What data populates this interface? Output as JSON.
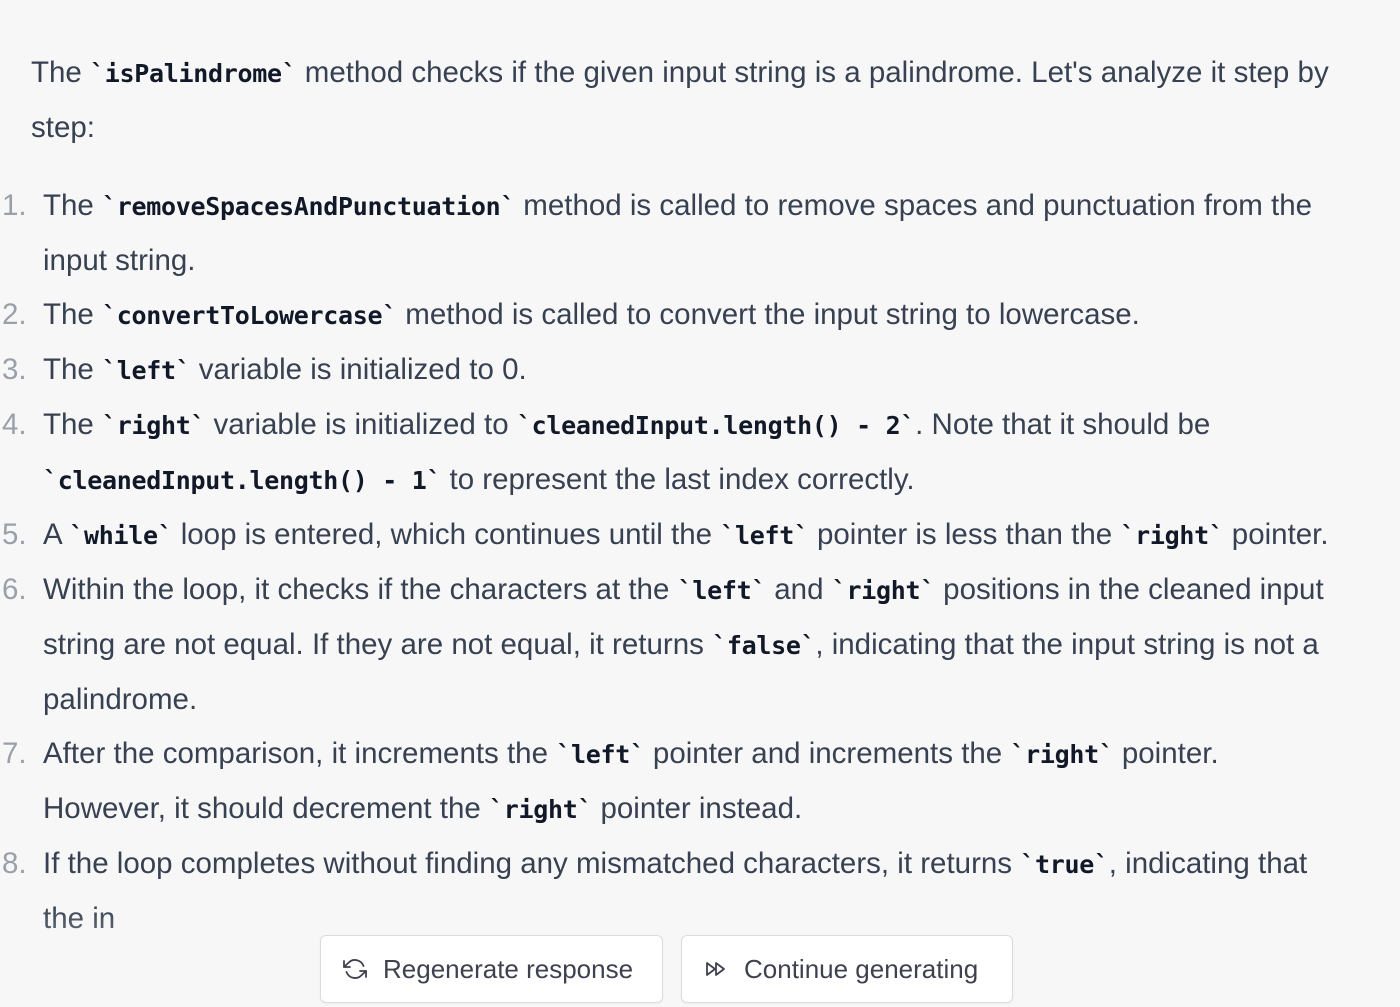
{
  "intro": {
    "t1": "The ",
    "c1": "`isPalindrome`",
    "t2": " method checks if the given input string is a palindrome. Let's analyze it step by step:"
  },
  "steps": [
    {
      "number": "1.",
      "t1": "The ",
      "c1": "`removeSpacesAndPunctuation`",
      "t2": " method is called to remove spaces and punctuation from the input string."
    },
    {
      "number": "2.",
      "t1": "The ",
      "c1": "`convertToLowercase`",
      "t2": " method is called to convert the input string to lowercase."
    },
    {
      "number": "3.",
      "t1": "The ",
      "c1": "`left`",
      "t2": " variable is initialized to 0."
    },
    {
      "number": "4.",
      "t1": "The ",
      "c1": "`right`",
      "t2": " variable is initialized to ",
      "c2": "`cleanedInput.length() - 2`",
      "t3": ". Note that it should be ",
      "c3": "`cleanedInput.length() - 1`",
      "t4": " to represent the last index correctly."
    },
    {
      "number": "5.",
      "t1": "A ",
      "c1": "`while`",
      "t2": " loop is entered, which continues until the ",
      "c2": "`left`",
      "t3": " pointer is less than the ",
      "c3": "`right`",
      "t4": " pointer."
    },
    {
      "number": "6.",
      "t1": "Within the loop, it checks if the characters at the ",
      "c1": "`left`",
      "t2": " and ",
      "c2": "`right`",
      "t3": " positions in the cleaned input string are not equal. If they are not equal, it returns ",
      "c3": "`false`",
      "t4": ", indicating that the input string is not a palindrome."
    },
    {
      "number": "7.",
      "t1": "After the comparison, it increments the ",
      "c1": "`left`",
      "t2": " pointer and increments the ",
      "c2": "`right`",
      "t3": " pointer. However, it should decrement the ",
      "c3": "`right`",
      "t4": " pointer instead."
    },
    {
      "number": "8.",
      "t1": "If the loop completes without finding any mismatched characters, it returns ",
      "c1": "`true`",
      "t2": ", indicating that the in"
    }
  ],
  "buttons": {
    "regenerate_label": "Regenerate response",
    "regenerate_icon": "refresh-icon",
    "continue_label": "Continue generating",
    "continue_icon": "fast-forward-icon"
  }
}
